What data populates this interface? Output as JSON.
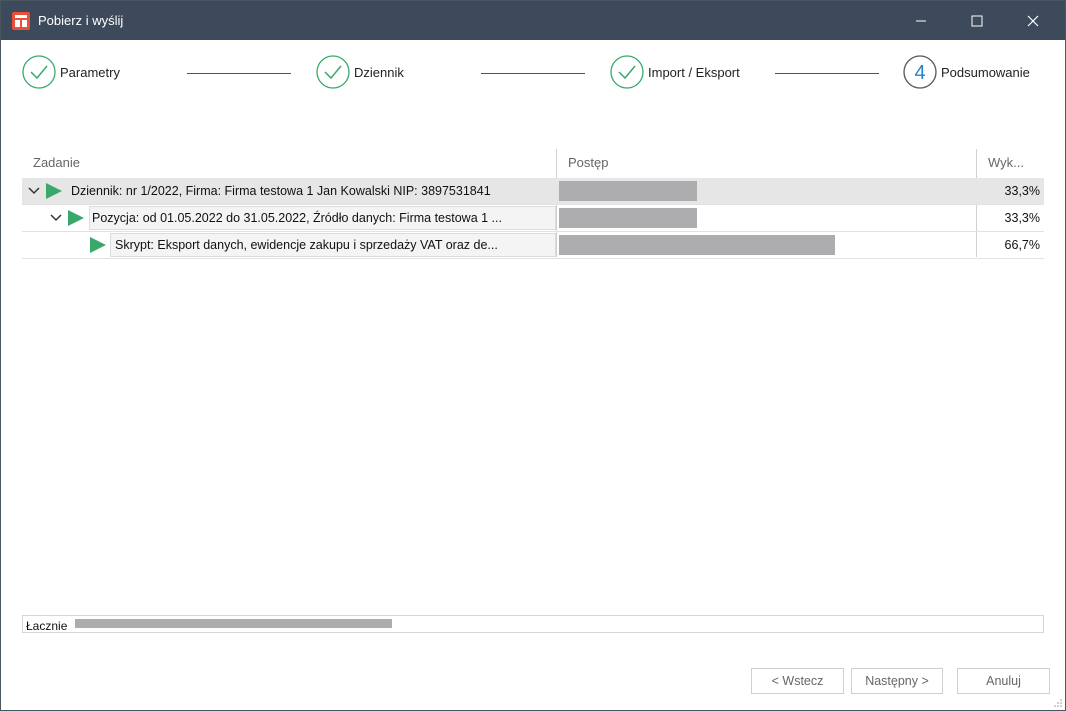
{
  "window": {
    "title": "Pobierz i wyślij",
    "accent": "#3c4a5c"
  },
  "wizard": {
    "steps": [
      {
        "label": "Parametry",
        "state": "done"
      },
      {
        "label": "Dziennik",
        "state": "done"
      },
      {
        "label": "Import / Eksport",
        "state": "done"
      },
      {
        "label": "Podsumowanie",
        "state": "current",
        "number": "4"
      }
    ]
  },
  "grid": {
    "headers": {
      "task": "Zadanie",
      "progress": "Postęp",
      "done": "Wyk..."
    },
    "rows": [
      {
        "text": "Dziennik: nr 1/2022, Firma: Firma testowa 1 Jan Kowalski NIP: 3897531841",
        "pct": "33,3%",
        "progress": 0.333,
        "level": 0
      },
      {
        "text": "Pozycja: od 01.05.2022 do 31.05.2022, Źródło danych: Firma testowa 1 ...",
        "pct": "33,3%",
        "progress": 0.333,
        "level": 1
      },
      {
        "text": "Skrypt: Eksport danych, ewidencje zakupu i sprzedaży VAT oraz de...",
        "pct": "66,7%",
        "progress": 0.667,
        "level": 2
      }
    ]
  },
  "total": {
    "label": "Łacznie",
    "progress": 0.33
  },
  "buttons": {
    "back": "< Wstecz",
    "next": "Następny >",
    "cancel": "Anuluj"
  },
  "colors": {
    "check": "#3aa86b",
    "current_step": "#2b7fc9",
    "bar": "#adadaf"
  }
}
